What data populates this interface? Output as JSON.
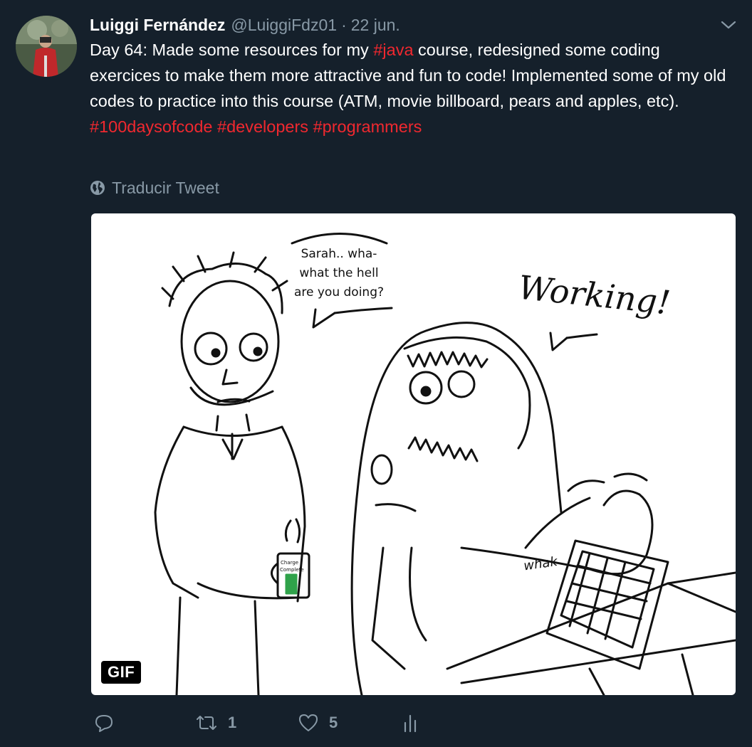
{
  "tweet": {
    "author_name": "Luiggi Fernández",
    "author_handle": "@LuiggiFdz01",
    "separator": "·",
    "date": "22 jun.",
    "text_parts": {
      "p1_a": "Day 64: Made some resources for my ",
      "p1_hashtag": "#java",
      "p1_b": " course, redesigned some coding exercices to make them more attractive and fun to code! Implemented some of my old codes to practice into this course (ATM, movie billboard, pears and apples, etc).",
      "hashtag_1": "#100daysofcode",
      "hashtag_2": "#developers",
      "hashtag_3": "#programmers"
    },
    "translate_label": "Traducir Tweet"
  },
  "media": {
    "badge": "GIF",
    "speech_1_line1": "Sarah.. wha-",
    "speech_1_line2": "what the hell",
    "speech_1_line3": "are you doing?",
    "speech_2": "Working!",
    "mug_line1": "Charge",
    "mug_line2": "Complete",
    "sound_text": "whak"
  },
  "actions": {
    "reply_count": "",
    "retweet_count": "1",
    "like_count": "5"
  },
  "icons": {
    "avatar": "avatar-photo",
    "menu": "chevron-down-icon",
    "translate": "globe-icon",
    "reply": "reply-icon",
    "retweet": "retweet-icon",
    "like": "heart-icon",
    "analytics": "analytics-icon"
  },
  "colors": {
    "background": "#15202b",
    "text": "#ffffff",
    "muted": "#8899a6",
    "hashtag": "#f0282f"
  }
}
